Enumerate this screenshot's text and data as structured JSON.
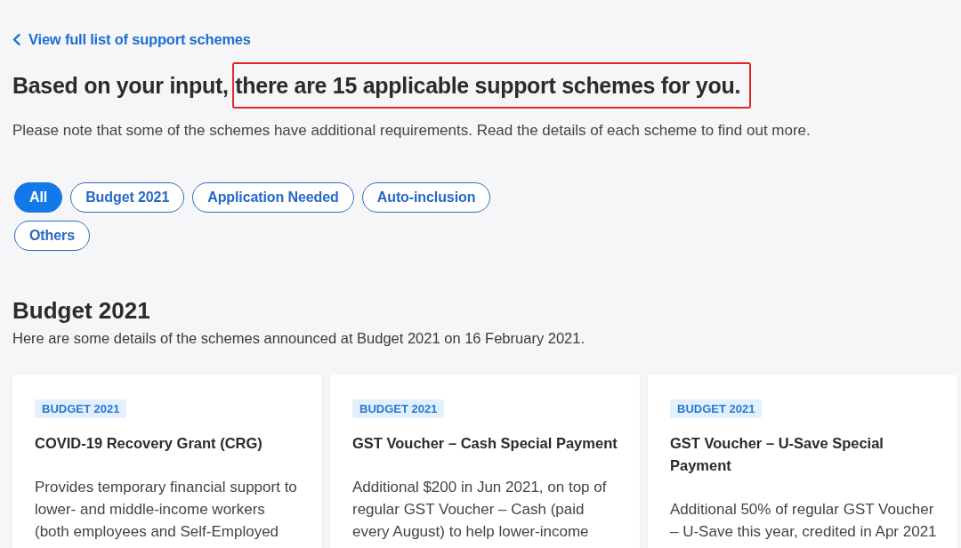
{
  "back_link": {
    "label": "View full list of support schemes"
  },
  "heading": {
    "text": "Based on your input,",
    "highlight": "there are 15 applicable support schemes for you."
  },
  "note": "Please note that some of the schemes have additional requirements. Read the details of each scheme to find out more.",
  "filters": [
    {
      "label": "All",
      "selected": true
    },
    {
      "label": "Budget 2021",
      "selected": false
    },
    {
      "label": "Application Needed",
      "selected": false
    },
    {
      "label": "Auto-inclusion",
      "selected": false
    },
    {
      "label": "Others",
      "selected": false
    }
  ],
  "section": {
    "title": "Budget 2021",
    "subtitle": "Here are some details of the schemes announced at Budget 2021 on 16 February 2021.",
    "cards": [
      {
        "tag": "BUDGET 2021",
        "title": "COVID-19 Recovery Grant (CRG)",
        "description": "Provides temporary financial support to lower- and middle-income workers (both employees and Self-Employed"
      },
      {
        "tag": "BUDGET 2021",
        "title": "GST Voucher – Cash Special Payment",
        "description": "Additional $200 in Jun 2021, on top of regular GST Voucher – Cash (paid every August) to help lower-income"
      },
      {
        "tag": "BUDGET 2021",
        "title": "GST Voucher – U-Save Special Payment",
        "description": "Additional 50% of regular GST Voucher – U-Save this year, credited in Apr 2021"
      }
    ]
  }
}
